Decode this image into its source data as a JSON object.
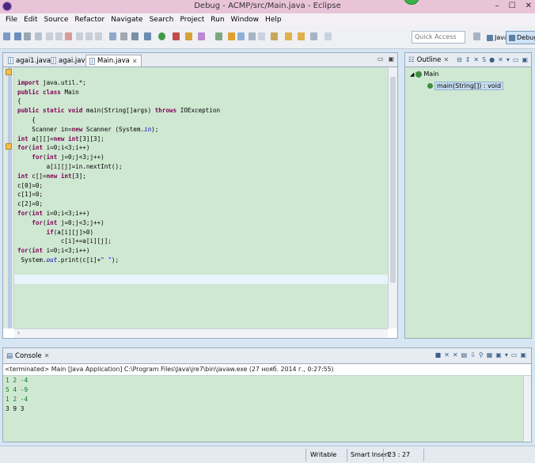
{
  "window": {
    "title": "Debug - ACMP/src/Main.java - Eclipse",
    "controls": [
      "–",
      "☐",
      "✕"
    ]
  },
  "menu": [
    "File",
    "Edit",
    "Source",
    "Refactor",
    "Navigate",
    "Search",
    "Project",
    "Run",
    "Window",
    "Help"
  ],
  "toolbar": {
    "quick_access_placeholder": "Quick Access",
    "perspectives": [
      {
        "label": "Java"
      },
      {
        "label": "Debug",
        "active": true
      }
    ]
  },
  "editor": {
    "tabs": [
      {
        "label": "agai1.java",
        "active": false
      },
      {
        "label": "agai.java",
        "active": false
      },
      {
        "label": "Main.java",
        "active": true
      }
    ],
    "lines": [
      "import java.util.*;",
      "",
      "",
      "public class Main",
      "{",
      "public static void main(String[]args) throws IOException",
      "",
      "",
      "    {",
      "    Scanner in=new Scanner (System.in);",
      "int a[][]=new int[3][3];",
      "for(int i=0;i<3;i++)",
      "    for(int j=0;j<3;j++)",
      "        a[i][j]=in.nextInt();",
      "int c[]=new int[3];",
      "c[0]=0;",
      "c[1]=0;",
      "c[2]=0;",
      "for(int i=0;i<3;i++)",
      "    for(int j=0;j<3;j++)",
      "        if(a[i][j]>0)",
      "            c[i]+=a[i][j];",
      "",
      "for(int i=0;i<3;i++)",
      " System.out.print(c[i]+\" \");"
    ]
  },
  "outline": {
    "title": "Outline",
    "class_name": "Main",
    "method_label": "main(String[]) : void"
  },
  "console": {
    "title": "Console",
    "terminated": "<terminated> Main [Java Application] C:\\Program Files\\Java\\jre7\\bin\\javaw.exe (27 нояб. 2014 г., 0:27:55)",
    "input_lines": [
      "1 2 -4",
      "5 4 -9",
      "1 2 -4"
    ],
    "output_lines": [
      "3 9 3"
    ]
  },
  "status": {
    "writable": "Writable",
    "insert_mode": "Smart Insert",
    "position": "23 : 27"
  }
}
